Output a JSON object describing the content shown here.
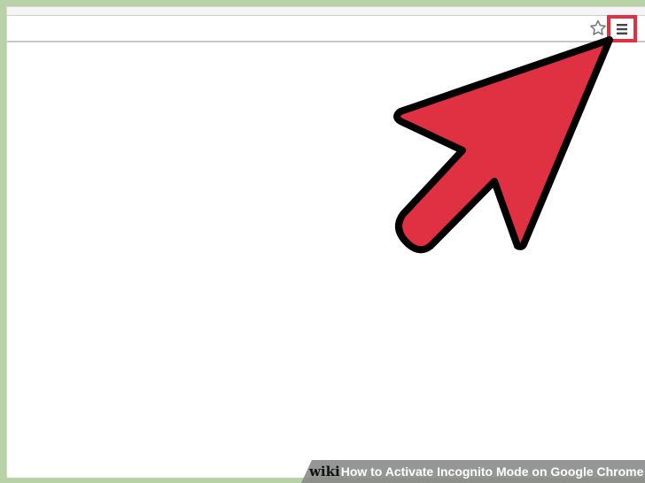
{
  "caption": {
    "brand": "wiki",
    "title": "How to Activate Incognito Mode on Google Chrome"
  },
  "icons": {
    "bookmark": "star-icon",
    "menu": "menu-icon",
    "pointer": "arrow-icon"
  },
  "colors": {
    "background": "#b9d1a6",
    "highlight": "#e03142",
    "arrow_fill": "#df3142",
    "arrow_outline": "#000000",
    "caption_background": "#878787"
  }
}
